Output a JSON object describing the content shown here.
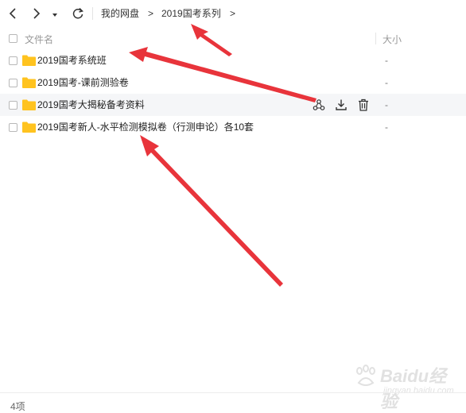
{
  "toolbar": {
    "breadcrumb": [
      {
        "label": "我的网盘"
      },
      {
        "label": "2019国考系列"
      }
    ],
    "crumb_separator": ">"
  },
  "columns": {
    "name": "文件名",
    "size": "大小"
  },
  "rows": [
    {
      "name": "2019国考系统班",
      "size": "-"
    },
    {
      "name": "2019国考-课前测验卷",
      "size": "-"
    },
    {
      "name": "2019国考大揭秘备考资料",
      "size": "-"
    },
    {
      "name": "2019国考新人-水平检测模拟卷（行测申论）各10套",
      "size": "-"
    }
  ],
  "footer": {
    "count": "4项"
  },
  "watermark": {
    "line1": "Baidu经验",
    "line2": "jingyan.baidu.com"
  },
  "colors": {
    "folder": "#FFC31F",
    "arrow": "#E8343B",
    "hover_row": "#f5f6f8"
  },
  "icons": [
    "back-icon",
    "forward-icon",
    "dropdown-icon",
    "refresh-icon",
    "folder-icon",
    "share-icon",
    "download-icon",
    "delete-icon"
  ]
}
